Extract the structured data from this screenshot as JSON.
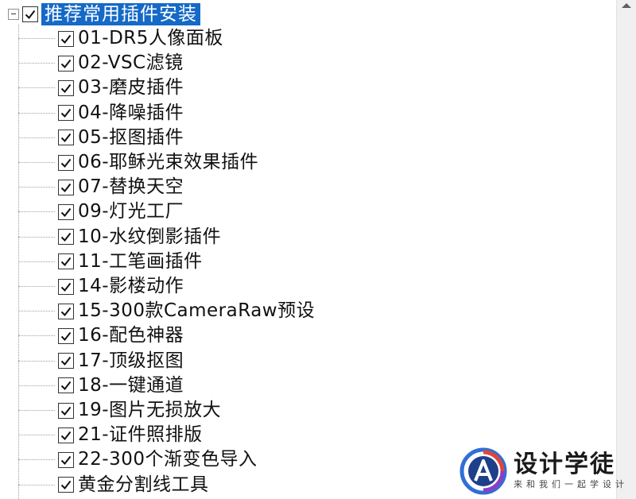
{
  "tree": {
    "root": {
      "label": "推荐常用插件安装",
      "checked": true,
      "expanded": true
    },
    "items": [
      {
        "label": "01-DR5人像面板",
        "checked": true
      },
      {
        "label": "02-VSC滤镜",
        "checked": true
      },
      {
        "label": "03-磨皮插件",
        "checked": true
      },
      {
        "label": "04-降噪插件",
        "checked": true
      },
      {
        "label": "05-抠图插件",
        "checked": true
      },
      {
        "label": "06-耶稣光束效果插件",
        "checked": true
      },
      {
        "label": "07-替换天空",
        "checked": true
      },
      {
        "label": "09-灯光工厂",
        "checked": true
      },
      {
        "label": "10-水纹倒影插件",
        "checked": true
      },
      {
        "label": "11-工笔画插件",
        "checked": true
      },
      {
        "label": "14-影楼动作",
        "checked": true
      },
      {
        "label": "15-300款CameraRaw预设",
        "checked": true
      },
      {
        "label": "16-配色神器",
        "checked": true
      },
      {
        "label": "17-顶级抠图",
        "checked": true
      },
      {
        "label": "18-一键通道",
        "checked": true
      },
      {
        "label": "19-图片无损放大",
        "checked": true
      },
      {
        "label": "21-证件照排版",
        "checked": true
      },
      {
        "label": "22-300个渐变色导入",
        "checked": true
      },
      {
        "label": "黄金分割线工具",
        "checked": true
      }
    ]
  },
  "watermark": {
    "title": "设计学徒",
    "subtitle": "来和我们一起学设计",
    "logo_icon": "letter-a-circle-logo"
  },
  "colors": {
    "selection": "#1569c7",
    "selection_text": "#ffffff",
    "text": "#111111"
  }
}
